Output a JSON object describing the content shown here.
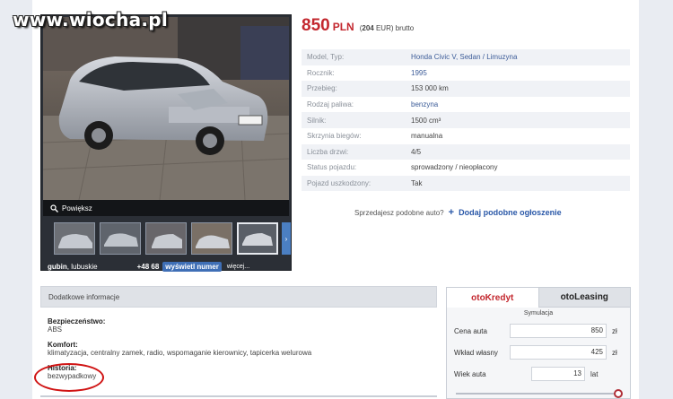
{
  "watermark": "www.wiocha.pl",
  "gallery": {
    "zoom_label": "Powiększ",
    "thumb_count": 5,
    "location_city": "gubin",
    "location_region": ", lubuskie",
    "phone": "+48 68",
    "show_number_label": "wyświetl numer",
    "more_label": "więcej...",
    "next_arrow": "›"
  },
  "price": {
    "amount": "850",
    "currency": "PLN",
    "eur_open": "(",
    "eur_amount": "204",
    "eur_rest": " EUR) brutto"
  },
  "specs": [
    {
      "label": "Model, Typ:",
      "value": "Honda Civic V, Sedan / Limuzyna",
      "link": true
    },
    {
      "label": "Rocznik:",
      "value": "1995",
      "link": true
    },
    {
      "label": "Przebieg:",
      "value": "153 000 km",
      "link": false
    },
    {
      "label": "Rodzaj paliwa:",
      "value": "benzyna",
      "link": true
    },
    {
      "label": "Silnik:",
      "value": "1500 cm³",
      "link": false
    },
    {
      "label": "Skrzynia biegów:",
      "value": "manualna",
      "link": false
    },
    {
      "label": "Liczba drzwi:",
      "value": "4/5",
      "link": false
    },
    {
      "label": "Status pojazdu:",
      "value": "sprowadzony / nieopłacony",
      "link": false
    },
    {
      "label": "Pojazd uszkodzony:",
      "value": "Tak",
      "link": false
    }
  ],
  "similar": {
    "question": "Sprzedajesz podobne auto?",
    "plus": "+",
    "add_label": "Dodaj podobne ogłoszenie"
  },
  "info": {
    "header": "Dodatkowe informacje",
    "sections": [
      {
        "title": "Bezpieczeństwo:",
        "text": "ABS"
      },
      {
        "title": "Komfort:",
        "text": "klimatyzacja, centralny zamek, radio, wspomaganie kierownicy, tapicerka welurowa"
      },
      {
        "title": "Historia:",
        "text": "bezwypadkowy"
      }
    ]
  },
  "widget": {
    "tab_kredyt": "otoKredyt",
    "tab_leasing": "otoLeasing",
    "simulation_label": "Symulacja",
    "rows": [
      {
        "label": "Cena auta",
        "value": "850",
        "unit": "zł"
      },
      {
        "label": "Wkład własny",
        "value": "425",
        "unit": "zł"
      },
      {
        "label": "Wiek auta",
        "value": "13",
        "unit": "lat"
      }
    ],
    "accent": "#c3272e"
  },
  "colors": {
    "price": "#c3272e",
    "link": "#3c5c98",
    "add_link": "#2a58a8",
    "highlight_circle": "#d01414"
  }
}
